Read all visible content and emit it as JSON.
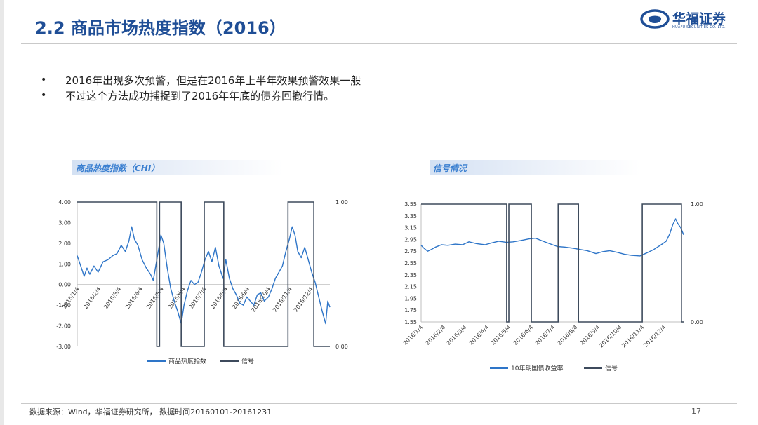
{
  "header": {
    "title": "2.2  商品市场热度指数（2016）",
    "logo_text": "华福证券",
    "logo_sub": "HUAFU SECURITIES CO.,LTD."
  },
  "bullets": [
    "2016年出现多次预警，但是在2016年上半年效果预警效果一般",
    "不过这个方法成功捕捉到了2016年年底的债券回撤行情。"
  ],
  "left_panel": {
    "header": "商品热度指数（CHI）"
  },
  "right_panel": {
    "header": "信号情况"
  },
  "footer": {
    "source": "数据来源：Wind，华福证券研究所， 数据时间20160101-20161231",
    "page": "17"
  },
  "colors": {
    "title": "#1f4e96",
    "series_blue": "#2e75c8",
    "signal": "#3d4a5c",
    "header_text": "#3a7fd0"
  },
  "chart_data": [
    {
      "type": "line",
      "x_dates": [
        "2016/1/4",
        "2016/2/4",
        "2016/3/4",
        "2016/4/4",
        "2016/5/4",
        "2016/6/4",
        "2016/7/4",
        "2016/8/4",
        "2016/9/4",
        "2016/10/4",
        "2016/11/4",
        "2016/12/4"
      ],
      "y_left_ticks": [
        "4.00",
        "3.00",
        "2.00",
        "1.00",
        "0.00",
        "-1.00",
        "-2.00",
        "-3.00"
      ],
      "y_left_range": [
        -3,
        4
      ],
      "y_right_ticks": [
        "1.00",
        "0.00"
      ],
      "y_right_range": [
        0,
        1
      ],
      "series": [
        {
          "name": "商品热度指数",
          "axis": "left",
          "points": [
            [
              "2016-01-04",
              1.4
            ],
            [
              "2016-01-09",
              0.9
            ],
            [
              "2016-01-14",
              0.4
            ],
            [
              "2016-01-18",
              0.8
            ],
            [
              "2016-01-22",
              0.5
            ],
            [
              "2016-01-28",
              0.9
            ],
            [
              "2016-02-03",
              0.6
            ],
            [
              "2016-02-10",
              1.1
            ],
            [
              "2016-02-17",
              1.2
            ],
            [
              "2016-02-24",
              1.4
            ],
            [
              "2016-03-01",
              1.5
            ],
            [
              "2016-03-07",
              1.9
            ],
            [
              "2016-03-13",
              1.6
            ],
            [
              "2016-03-18",
              2.1
            ],
            [
              "2016-03-22",
              2.8
            ],
            [
              "2016-03-26",
              2.2
            ],
            [
              "2016-03-31",
              1.9
            ],
            [
              "2016-04-06",
              1.2
            ],
            [
              "2016-04-12",
              0.8
            ],
            [
              "2016-04-18",
              0.5
            ],
            [
              "2016-04-22",
              0.2
            ],
            [
              "2016-04-26",
              1.0
            ],
            [
              "2016-04-30",
              1.8
            ],
            [
              "2016-05-03",
              2.4
            ],
            [
              "2016-05-07",
              2.0
            ],
            [
              "2016-05-12",
              0.8
            ],
            [
              "2016-05-17",
              -0.2
            ],
            [
              "2016-05-22",
              -0.8
            ],
            [
              "2016-05-27",
              -1.3
            ],
            [
              "2016-06-01",
              -1.9
            ],
            [
              "2016-06-05",
              -1.0
            ],
            [
              "2016-06-10",
              -0.3
            ],
            [
              "2016-06-15",
              0.2
            ],
            [
              "2016-06-20",
              0.0
            ],
            [
              "2016-06-25",
              0.1
            ],
            [
              "2016-06-30",
              0.6
            ],
            [
              "2016-07-05",
              1.2
            ],
            [
              "2016-07-10",
              1.6
            ],
            [
              "2016-07-15",
              1.1
            ],
            [
              "2016-07-20",
              1.8
            ],
            [
              "2016-07-25",
              0.9
            ],
            [
              "2016-07-31",
              0.3
            ],
            [
              "2016-08-04",
              1.2
            ],
            [
              "2016-08-09",
              0.3
            ],
            [
              "2016-08-14",
              -0.2
            ],
            [
              "2016-08-19",
              -0.5
            ],
            [
              "2016-08-24",
              -0.9
            ],
            [
              "2016-08-29",
              -1.0
            ],
            [
              "2016-09-03",
              -0.6
            ],
            [
              "2016-09-08",
              -0.8
            ],
            [
              "2016-09-13",
              -1.0
            ],
            [
              "2016-09-18",
              -0.5
            ],
            [
              "2016-09-23",
              -0.4
            ],
            [
              "2016-09-28",
              -0.8
            ],
            [
              "2016-10-04",
              -0.6
            ],
            [
              "2016-10-09",
              -0.2
            ],
            [
              "2016-10-14",
              0.3
            ],
            [
              "2016-10-19",
              0.6
            ],
            [
              "2016-10-24",
              0.9
            ],
            [
              "2016-10-29",
              1.6
            ],
            [
              "2016-11-03",
              2.2
            ],
            [
              "2016-11-07",
              2.8
            ],
            [
              "2016-11-11",
              2.4
            ],
            [
              "2016-11-15",
              1.6
            ],
            [
              "2016-11-20",
              1.3
            ],
            [
              "2016-11-25",
              1.8
            ],
            [
              "2016-11-30",
              1.2
            ],
            [
              "2016-12-05",
              0.6
            ],
            [
              "2016-12-10",
              0.1
            ],
            [
              "2016-12-15",
              -0.6
            ],
            [
              "2016-12-20",
              -1.3
            ],
            [
              "2016-12-25",
              -1.9
            ],
            [
              "2016-12-28",
              -0.8
            ],
            [
              "2016-12-31",
              -1.1
            ]
          ]
        },
        {
          "name": "信号",
          "axis": "right",
          "step_points": [
            [
              "2016-01-04",
              1
            ],
            [
              "2016-04-27",
              0
            ],
            [
              "2016-05-01",
              1
            ],
            [
              "2016-06-01",
              0
            ],
            [
              "2016-07-04",
              1
            ],
            [
              "2016-08-01",
              0
            ],
            [
              "2016-11-01",
              1
            ],
            [
              "2016-12-08",
              0
            ],
            [
              "2016-12-31",
              0
            ]
          ]
        }
      ]
    },
    {
      "type": "line",
      "x_dates": [
        "2016/1/4",
        "2016/2/4",
        "2016/3/4",
        "2016/4/4",
        "2016/5/4",
        "2016/6/4",
        "2016/7/4",
        "2016/8/4",
        "2016/9/4",
        "2016/10/4",
        "2016/11/4",
        "2016/12/4"
      ],
      "y_left_ticks": [
        "3.55",
        "3.35",
        "3.15",
        "2.95",
        "2.75",
        "2.55",
        "2.35",
        "2.15",
        "1.95",
        "1.75",
        "1.55"
      ],
      "y_left_range": [
        1.55,
        3.55
      ],
      "y_right_ticks": [
        "1.00",
        "0.00"
      ],
      "y_right_range": [
        0,
        1
      ],
      "series": [
        {
          "name": "10年期国债收益率",
          "axis": "left",
          "points": [
            [
              "2016-01-04",
              2.85
            ],
            [
              "2016-01-08",
              2.8
            ],
            [
              "2016-01-13",
              2.75
            ],
            [
              "2016-01-18",
              2.78
            ],
            [
              "2016-01-24",
              2.82
            ],
            [
              "2016-02-01",
              2.86
            ],
            [
              "2016-02-10",
              2.85
            ],
            [
              "2016-02-20",
              2.87
            ],
            [
              "2016-03-01",
              2.86
            ],
            [
              "2016-03-10",
              2.91
            ],
            [
              "2016-03-20",
              2.88
            ],
            [
              "2016-04-01",
              2.86
            ],
            [
              "2016-04-10",
              2.89
            ],
            [
              "2016-04-20",
              2.92
            ],
            [
              "2016-05-01",
              2.9
            ],
            [
              "2016-05-10",
              2.91
            ],
            [
              "2016-05-20",
              2.93
            ],
            [
              "2016-06-01",
              2.96
            ],
            [
              "2016-06-10",
              2.97
            ],
            [
              "2016-06-20",
              2.92
            ],
            [
              "2016-07-01",
              2.87
            ],
            [
              "2016-07-10",
              2.83
            ],
            [
              "2016-07-20",
              2.82
            ],
            [
              "2016-08-01",
              2.8
            ],
            [
              "2016-08-10",
              2.78
            ],
            [
              "2016-08-20",
              2.76
            ],
            [
              "2016-09-01",
              2.71
            ],
            [
              "2016-09-10",
              2.74
            ],
            [
              "2016-09-20",
              2.76
            ],
            [
              "2016-10-01",
              2.73
            ],
            [
              "2016-10-10",
              2.7
            ],
            [
              "2016-10-20",
              2.68
            ],
            [
              "2016-11-01",
              2.67
            ],
            [
              "2016-11-10",
              2.72
            ],
            [
              "2016-11-20",
              2.78
            ],
            [
              "2016-11-30",
              2.86
            ],
            [
              "2016-12-07",
              2.92
            ],
            [
              "2016-12-12",
              3.05
            ],
            [
              "2016-12-16",
              3.2
            ],
            [
              "2016-12-20",
              3.3
            ],
            [
              "2016-12-23",
              3.22
            ],
            [
              "2016-12-27",
              3.15
            ],
            [
              "2016-12-31",
              3.03
            ]
          ]
        },
        {
          "name": "信号",
          "axis": "right",
          "step_points": [
            [
              "2016-01-04",
              1
            ],
            [
              "2016-05-01",
              0
            ],
            [
              "2016-05-04",
              1
            ],
            [
              "2016-06-04",
              0
            ],
            [
              "2016-07-11",
              1
            ],
            [
              "2016-08-08",
              0
            ],
            [
              "2016-11-04",
              1
            ],
            [
              "2016-12-28",
              0
            ],
            [
              "2016-12-31",
              0
            ]
          ]
        }
      ]
    }
  ]
}
